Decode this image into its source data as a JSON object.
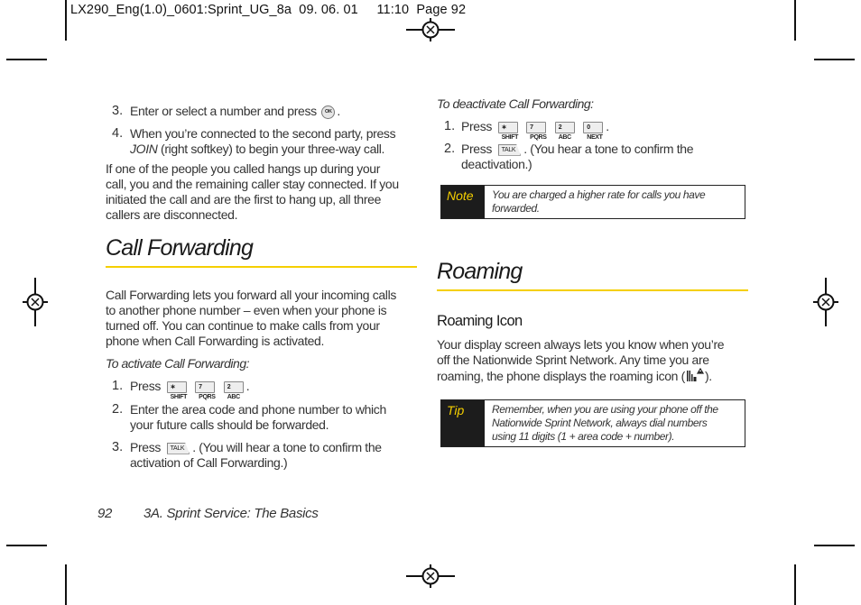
{
  "print_header": "LX290_Eng(1.0)_0601:Sprint_UG_8a  09. 06. 01     11:10  Page 92",
  "left_column": {
    "steps_top": [
      {
        "num": "3.",
        "text_before": "Enter or select a number and press",
        "key": "MENU OK",
        "text_after": "."
      },
      {
        "num": "4.",
        "line1": "When you’re connected to the second party, press",
        "softkey": "JOIN",
        "line2_rest": " (right softkey) to begin your three-way call."
      }
    ],
    "paragraph": [
      "If one of the people you called hangs up during your",
      "call, you and the remaining caller stay connected. If you",
      "initiated the call and are the first to hang up, all three",
      "callers are disconnected."
    ],
    "section_title": "Call Forwarding",
    "intro": [
      "Call Forwarding lets you forward all your incoming calls",
      "to another phone number – even when your phone is",
      "turned off. You can continue to make calls from your",
      "phone when Call Forwarding is activated."
    ],
    "activate_heading": "To activate Call Forwarding:",
    "activate_steps": [
      {
        "num": "1.",
        "text": "Press",
        "keys": [
          "∗ SHIFT",
          "7 PQRS",
          "2 ABC"
        ],
        "after": "."
      },
      {
        "num": "2.",
        "line1": "Enter the area code and phone number to which",
        "line2": "your future calls should be forwarded."
      },
      {
        "num": "3.",
        "text": "Press",
        "key": "TALK",
        "line1_rest": ". (You will hear a tone to confirm the",
        "line2": "activation of Call Forwarding.)"
      }
    ]
  },
  "right_column": {
    "deactivate_heading": "To deactivate Call Forwarding:",
    "deactivate_steps": [
      {
        "num": "1.",
        "text": "Press",
        "keys": [
          "∗ SHIFT",
          "7 PQRS",
          "2 ABC",
          "0 NEXT"
        ],
        "after": "."
      },
      {
        "num": "2.",
        "text": "Press",
        "key": "TALK",
        "line1_rest": ". (You hear a tone to confirm the",
        "line2": "deactivation.)"
      }
    ],
    "note": {
      "label": "Note",
      "lines": [
        "You are charged a higher rate for calls you have",
        "forwarded."
      ]
    },
    "section_title": "Roaming",
    "subheading": "Roaming Icon",
    "body": [
      "Your display screen always lets you know when you’re",
      "off the Nationwide Sprint Network. Any time you are",
      "roaming, the phone displays the roaming icon (",
      ")."
    ],
    "tip": {
      "label": "Tip",
      "lines": [
        "Remember, when you are using your phone off the",
        "Nationwide Sprint Network, always dial numbers",
        "using 11 digits (1 + area code + number)."
      ]
    }
  },
  "footer": {
    "page_number": "92",
    "section": "3A. Sprint Service: The Basics"
  },
  "colors": {
    "accent_rule": "#f5cf00",
    "box_label_bg": "#1c1c1c"
  }
}
